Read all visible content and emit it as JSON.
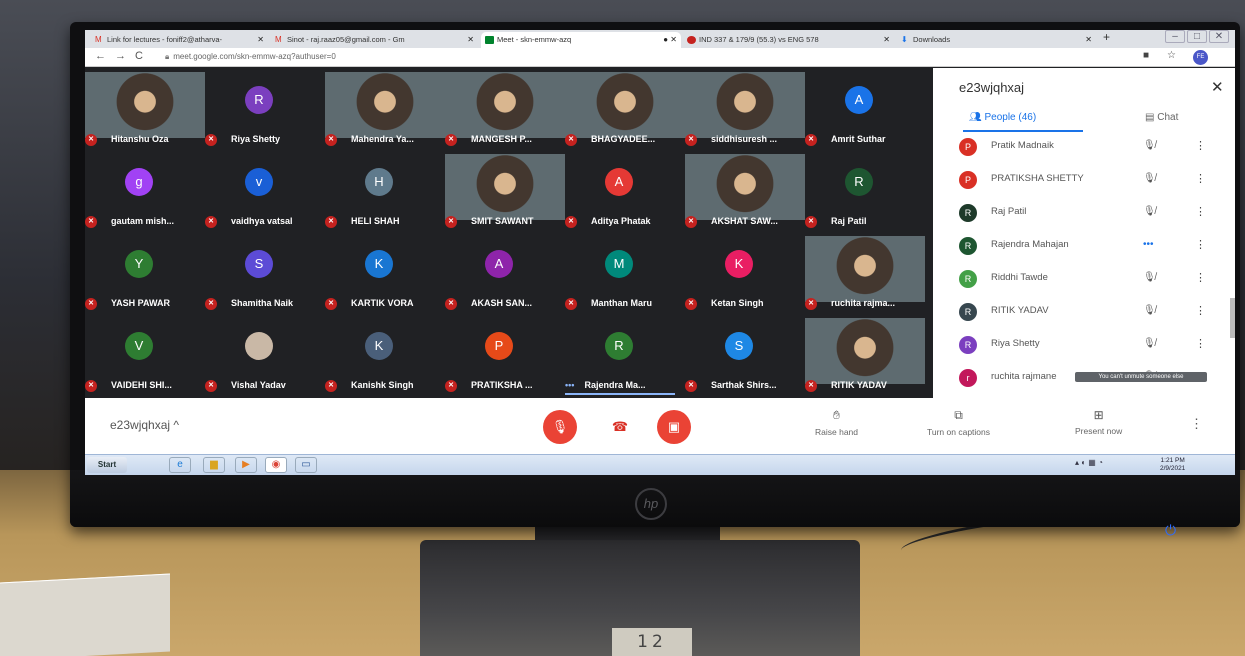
{
  "browser": {
    "tabs": [
      {
        "title": "Link for lectures - foniff2@atharva-"
      },
      {
        "title": "Sinot - raj.raaz05@gmail.com - Gm"
      },
      {
        "title": "Meet - skn-emmw-azq"
      },
      {
        "title": "IND 337 & 179/9 (55.3) vs ENG 578"
      },
      {
        "title": "Downloads"
      }
    ],
    "url": "meet.google.com/skn-emmw-azq?authuser=0",
    "profile_initials": "FE"
  },
  "participants_grid": [
    {
      "name": "Hitanshu Oza",
      "type": "video"
    },
    {
      "name": "Riya Shetty",
      "type": "avatar",
      "initial": "R",
      "color": "#7b3fbf"
    },
    {
      "name": "Mahendra Ya...",
      "type": "video"
    },
    {
      "name": "MANGESH P...",
      "type": "video"
    },
    {
      "name": "BHAGYADEE...",
      "type": "video"
    },
    {
      "name": "siddhisuresh ...",
      "type": "video"
    },
    {
      "name": "Amrit Suthar",
      "type": "avatar",
      "initial": "A",
      "color": "#1a73e8"
    },
    {
      "name": "gautam mish...",
      "type": "avatar",
      "initial": "g",
      "color": "#a142f4"
    },
    {
      "name": "vaidhya vatsal",
      "type": "avatar",
      "initial": "v",
      "color": "#1a5fd6"
    },
    {
      "name": "HELI SHAH",
      "type": "avatar",
      "initial": "H",
      "color": "#5f7a8c"
    },
    {
      "name": "SMIT SAWANT",
      "type": "video"
    },
    {
      "name": "Aditya Phatak",
      "type": "avatar",
      "initial": "A",
      "color": "#e53935"
    },
    {
      "name": "AKSHAT SAW...",
      "type": "video"
    },
    {
      "name": "Raj Patil",
      "type": "avatar",
      "initial": "R",
      "color": "#1e5631"
    },
    {
      "name": "YASH PAWAR",
      "type": "avatar",
      "initial": "Y",
      "color": "#2e7d32"
    },
    {
      "name": "Shamitha Naik",
      "type": "avatar",
      "initial": "S",
      "color": "#5c4bd6"
    },
    {
      "name": "KARTIK VORA",
      "type": "avatar",
      "initial": "K",
      "color": "#1976d2"
    },
    {
      "name": "AKASH SAN...",
      "type": "avatar",
      "initial": "A",
      "color": "#8e24aa"
    },
    {
      "name": "Manthan Maru",
      "type": "avatar",
      "initial": "M",
      "color": "#00897b"
    },
    {
      "name": "Ketan Singh",
      "type": "avatar",
      "initial": "K",
      "color": "#e91e63"
    },
    {
      "name": "ruchita rajma...",
      "type": "video"
    },
    {
      "name": "VAIDEHI SHI...",
      "type": "avatar",
      "initial": "V",
      "color": "#2e7d32"
    },
    {
      "name": "Vishal Yadav",
      "type": "avatar",
      "initial": "",
      "color": "#c9b8a6"
    },
    {
      "name": "Kanishk Singh",
      "type": "avatar",
      "initial": "K",
      "color": "#4a5f7a"
    },
    {
      "name": "PRATIKSHA ...",
      "type": "avatar",
      "initial": "P",
      "color": "#e64a19"
    },
    {
      "name": "Rajendra Ma...",
      "type": "avatar",
      "initial": "R",
      "color": "#2e7d32",
      "speaking": true
    },
    {
      "name": "Sarthak Shirs...",
      "type": "avatar",
      "initial": "S",
      "color": "#1e88e5"
    },
    {
      "name": "RITIK YADAV",
      "type": "video"
    }
  ],
  "people_panel": {
    "meeting_code": "e23wjqhxaj",
    "people_tab": "People (46)",
    "chat_tab": "Chat",
    "participants": [
      {
        "name": "Pratik Madnaik",
        "initial": "P",
        "color": "#d93025",
        "mic": "muted"
      },
      {
        "name": "PRATIKSHA SHETTY",
        "initial": "P",
        "color": "#d93025",
        "mic": "muted"
      },
      {
        "name": "Raj Patil",
        "initial": "R",
        "color": "#1e3a2a",
        "mic": "muted"
      },
      {
        "name": "Rajendra Mahajan",
        "initial": "R",
        "color": "#1e5631",
        "mic": "speaking"
      },
      {
        "name": "Riddhi Tawde",
        "initial": "R",
        "color": "#43a047",
        "mic": "muted"
      },
      {
        "name": "RITIK YADAV",
        "initial": "R",
        "color": "#37474f",
        "mic": "muted"
      },
      {
        "name": "Riya Shetty",
        "initial": "R",
        "color": "#7b3fbf",
        "mic": "muted"
      },
      {
        "name": "ruchita rajmane",
        "initial": "r",
        "color": "#c2185b",
        "mic": "muted"
      }
    ],
    "tooltip": "You can't unmute someone else"
  },
  "bottom_bar": {
    "meeting_code": "e23wjqhxaj",
    "raise_hand": "Raise hand",
    "captions": "Turn on captions",
    "present": "Present now"
  },
  "taskbar": {
    "start": "Start",
    "time": "1:21 PM",
    "date": "2/9/2021"
  },
  "monitor": {
    "stand_label": "12"
  }
}
